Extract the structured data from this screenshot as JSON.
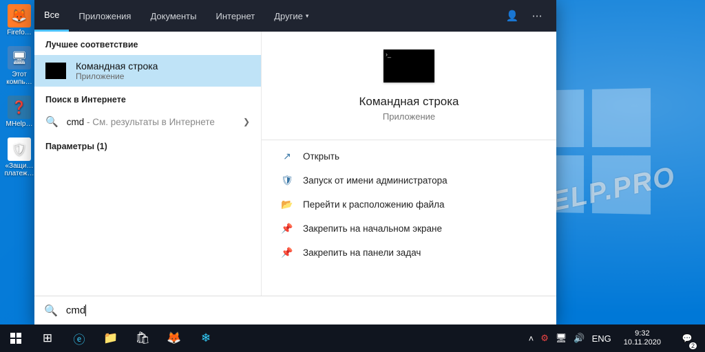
{
  "desktop": {
    "icons": [
      "Firefo…",
      "Этот компь…",
      "MHelp…",
      "«Защи… платеж…"
    ]
  },
  "tabs": {
    "items": [
      "Все",
      "Приложения",
      "Документы",
      "Интернет",
      "Другие"
    ],
    "active_index": 0
  },
  "left": {
    "best_match_h": "Лучшее соответствие",
    "best_match": {
      "title": "Командная строка",
      "subtitle": "Приложение"
    },
    "web_h": "Поиск в Интернете",
    "web": {
      "query": "cmd",
      "suffix": " - См. результаты в Интернете"
    },
    "settings_h": "Параметры (1)"
  },
  "preview": {
    "title": "Командная строка",
    "subtitle": "Приложение",
    "actions": [
      {
        "icon": "↗",
        "label": "Открыть"
      },
      {
        "icon": "🛡",
        "label": "Запуск от имени администратора"
      },
      {
        "icon": "📂",
        "label": "Перейти к расположению файла"
      },
      {
        "icon": "📌",
        "label": "Закрепить на начальном экране"
      },
      {
        "icon": "📌",
        "label": "Закрепить на панели задач"
      }
    ]
  },
  "search": {
    "value": "cmd"
  },
  "tray": {
    "lang": "ENG",
    "time": "9:32",
    "date": "10.11.2020",
    "notif_count": "2"
  },
  "watermark": "MHELP.PRO"
}
